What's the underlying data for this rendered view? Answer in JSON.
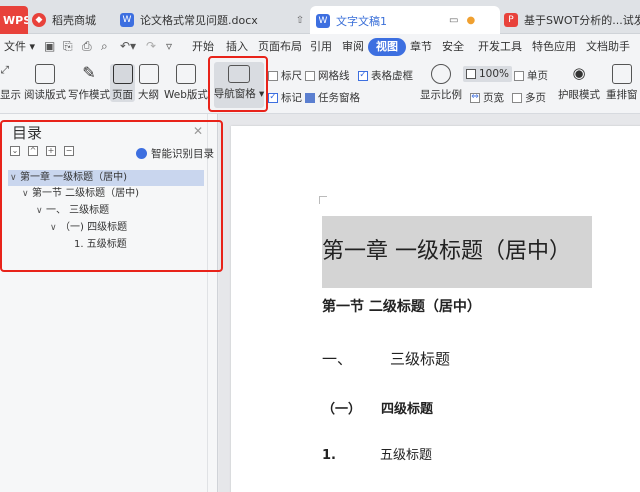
{
  "tabs": {
    "wps": "WPS",
    "shop": "稻壳商城",
    "doc1": "论文格式常见问题.docx",
    "active": "文字文稿1",
    "swot": "基于SWOT分析的...试发展策"
  },
  "menu": {
    "file": "文件",
    "items": [
      "开始",
      "插入",
      "页面布局",
      "引用",
      "审阅",
      "视图",
      "章节",
      "安全",
      "开发工具",
      "特色应用",
      "文档助手"
    ]
  },
  "ribbon": {
    "show": "显示",
    "reading": "阅读版式",
    "writing": "写作模式",
    "page": "页面",
    "outline": "大纲",
    "web": "Web版式",
    "nav_pane": "导航窗格",
    "ruler": "标尺",
    "gridlines": "网格线",
    "table_gridlines": "表格虚框",
    "markers": "标记",
    "task_pane": "任务窗格",
    "zoom_label": "显示比例",
    "zoom_value": "100%",
    "page_width": "页宽",
    "single_page": "单页",
    "multi_page": "多页",
    "eye_mode": "护眼模式",
    "rearrange": "重排窗"
  },
  "checks": {
    "ruler": false,
    "gridlines": false,
    "table_gridlines": true,
    "markers": true,
    "task_pane": false
  },
  "nav": {
    "title": "目录",
    "smart_label": "智能识别目录",
    "items": [
      {
        "label": "第一章  一级标题（居中)",
        "level": 1,
        "expanded": true
      },
      {
        "label": "第一节  二级标题（居中)",
        "level": 2,
        "expanded": true
      },
      {
        "label": "一、      三级标题",
        "level": 3,
        "expanded": true
      },
      {
        "label": "（一)    四级标题",
        "level": 4,
        "expanded": true
      },
      {
        "label": "1.          五级标题",
        "level": 5,
        "expanded": false
      }
    ]
  },
  "document": {
    "h1": "第一章  一级标题（居中）",
    "h2": "第一节  二级标题（居中）",
    "h3_num": "一、",
    "h3_text": "三级标题",
    "h4_num": "（一）",
    "h4_text": "四级标题",
    "h5_num": "1.",
    "h5_text": "五级标题"
  },
  "colors": {
    "accent": "#3d6fe0",
    "highlight_box": "#e8231a",
    "heading_bg": "#d4d4d4"
  }
}
